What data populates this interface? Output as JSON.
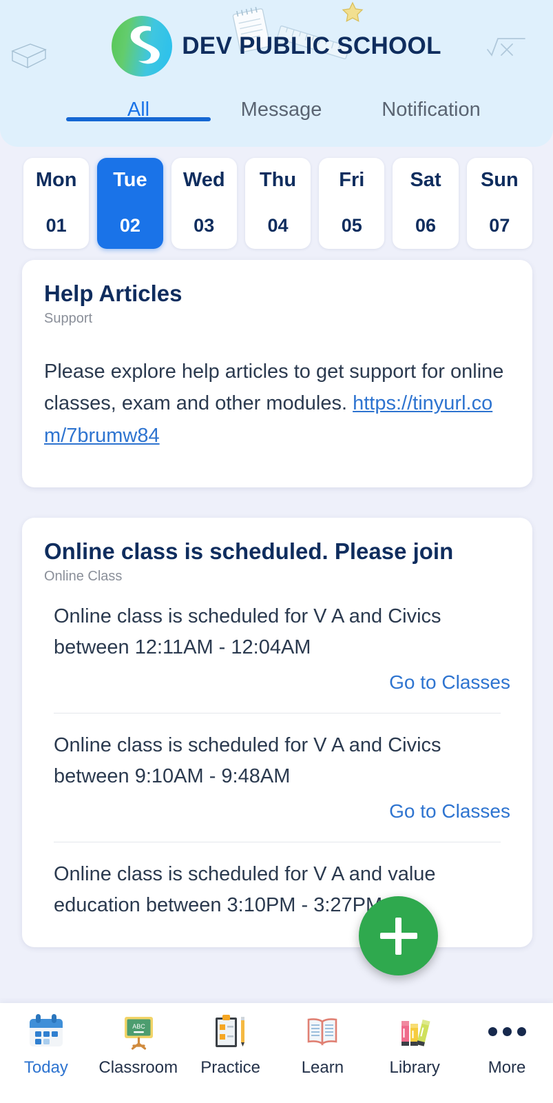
{
  "header": {
    "school_name": "DEV PUBLIC SCHOOL",
    "logo_icon": "school-logo-s-icon",
    "doodles": [
      "wireframe-cube-doodle",
      "notepad-doodle",
      "ruler-doodle",
      "star-doodle",
      "square-root-doodle"
    ],
    "tabs": [
      {
        "label": "All",
        "active": true
      },
      {
        "label": "Message",
        "active": false
      },
      {
        "label": "Notification",
        "active": false
      }
    ]
  },
  "date_strip": {
    "days": [
      {
        "dow": "Mon",
        "num": "01",
        "selected": false
      },
      {
        "dow": "Tue",
        "num": "02",
        "selected": true
      },
      {
        "dow": "Wed",
        "num": "03",
        "selected": false
      },
      {
        "dow": "Thu",
        "num": "04",
        "selected": false
      },
      {
        "dow": "Fri",
        "num": "05",
        "selected": false
      },
      {
        "dow": "Sat",
        "num": "06",
        "selected": false
      },
      {
        "dow": "Sun",
        "num": "07",
        "selected": false
      }
    ]
  },
  "cards": {
    "help": {
      "title": "Help Articles",
      "subtitle": "Support",
      "body_text": "Please explore help articles to get support for online classes, exam and other modules. ",
      "link_text": "https://tinyurl.com/7brumw84"
    },
    "online_class": {
      "title": "Online class is scheduled. Please join",
      "subtitle": "Online Class",
      "entries": [
        {
          "text": "Online class is scheduled for V A and Civics between 12:11AM - 12:04AM",
          "action": "Go to Classes"
        },
        {
          "text": "Online class is scheduled for V A and Civics between 9:10AM - 9:48AM",
          "action": "Go to Classes"
        },
        {
          "text": "Online class is scheduled for V A and value education between 3:10PM - 3:27PM",
          "action": ""
        }
      ]
    }
  },
  "fab": {
    "icon": "plus-icon",
    "label": "Add"
  },
  "bottom_nav": {
    "items": [
      {
        "label": "Today",
        "icon": "calendar-icon",
        "active": true
      },
      {
        "label": "Classroom",
        "icon": "chalkboard-abc-icon",
        "active": false
      },
      {
        "label": "Practice",
        "icon": "clipboard-pencil-icon",
        "active": false
      },
      {
        "label": "Learn",
        "icon": "open-book-icon",
        "active": false
      },
      {
        "label": "Library",
        "icon": "books-icon",
        "active": false
      },
      {
        "label": "More",
        "icon": "ellipsis-icon",
        "active": false
      }
    ]
  },
  "colors": {
    "accent_blue": "#1a73e8",
    "link_blue": "#2e74d0",
    "title_navy": "#0f2d5e",
    "fab_green": "#2fa94e",
    "header_bg": "#dff0fc",
    "page_bg": "#eef0fa"
  }
}
